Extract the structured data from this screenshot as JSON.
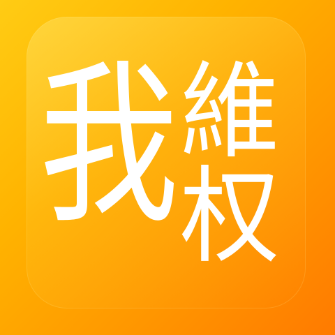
{
  "logo": {
    "char_left": "我",
    "char_right_top": "維",
    "char_right_bottom": "权"
  },
  "colors": {
    "gradient_top": "#ffcc14",
    "gradient_bottom": "#ff7a00",
    "text": "#ffffff"
  }
}
